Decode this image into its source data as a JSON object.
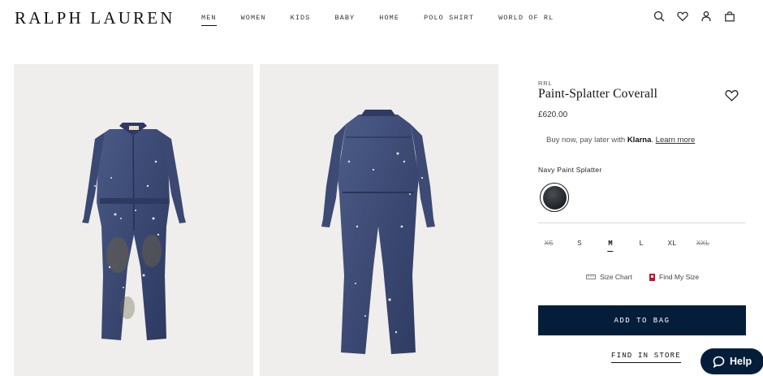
{
  "header": {
    "logo": "RALPH LAUREN",
    "nav": [
      {
        "label": "MEN",
        "active": true
      },
      {
        "label": "WOMEN"
      },
      {
        "label": "KIDS"
      },
      {
        "label": "BABY"
      },
      {
        "label": "HOME"
      },
      {
        "label": "POLO SHIRT"
      },
      {
        "label": "WORLD OF RL"
      }
    ],
    "icons": [
      "search-icon",
      "heart-icon",
      "account-icon",
      "bag-icon"
    ]
  },
  "product": {
    "brand": "RRL",
    "title": "Paint-Splatter Coverall",
    "price": "£620.00",
    "klarna_text": "Buy now, pay later with",
    "klarna_brand": "Klarna",
    "klarna_link": "Learn more",
    "color_name": "Navy Paint Splatter",
    "sizes": [
      {
        "label": "XS",
        "available": false
      },
      {
        "label": "S",
        "available": true
      },
      {
        "label": "M",
        "available": true,
        "selected": true
      },
      {
        "label": "L",
        "available": true
      },
      {
        "label": "XL",
        "available": true
      },
      {
        "label": "XXL",
        "available": false
      }
    ],
    "size_chart": "Size Chart",
    "find_my_size": "Find My Size",
    "add_to_bag": "ADD TO BAG",
    "find_in_store": "FIND IN STORE"
  },
  "help": {
    "label": "Help"
  },
  "colors": {
    "navy": "#041e3a",
    "image_bg": "#efeeec",
    "accent_red": "#c8102e"
  }
}
